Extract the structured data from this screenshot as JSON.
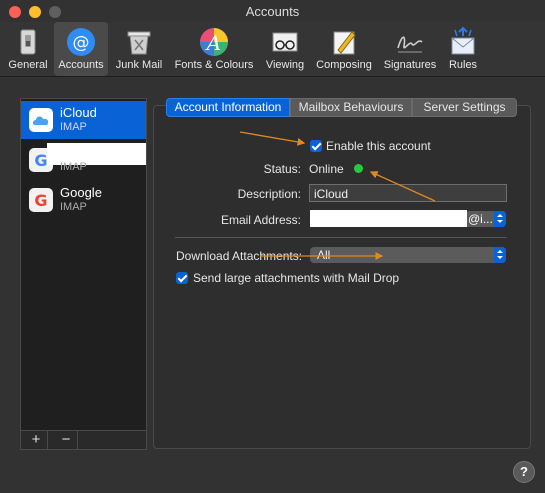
{
  "window": {
    "title": "Accounts"
  },
  "toolbar": {
    "items": [
      {
        "label": "General",
        "icon": "general-icon"
      },
      {
        "label": "Accounts",
        "icon": "accounts-icon"
      },
      {
        "label": "Junk Mail",
        "icon": "junk-mail-icon"
      },
      {
        "label": "Fonts & Colours",
        "icon": "fonts-colours-icon"
      },
      {
        "label": "Viewing",
        "icon": "viewing-icon"
      },
      {
        "label": "Composing",
        "icon": "composing-icon"
      },
      {
        "label": "Signatures",
        "icon": "signatures-icon"
      },
      {
        "label": "Rules",
        "icon": "rules-icon"
      }
    ],
    "selected": "Accounts"
  },
  "sidebar": {
    "accounts": [
      {
        "name": "iCloud",
        "type": "IMAP",
        "selected": true
      },
      {
        "name": "",
        "type": "IMAP",
        "selected": false
      },
      {
        "name": "Google",
        "type": "IMAP",
        "selected": false
      }
    ],
    "add_label": "+",
    "remove_label": "−"
  },
  "tabs": [
    "Account Information",
    "Mailbox Behaviours",
    "Server Settings"
  ],
  "account_info": {
    "enable_label": "Enable this account",
    "enable_checked": true,
    "status_label": "Status:",
    "status_value": "Online",
    "status_color": "#27c93f",
    "description_label": "Description:",
    "description_value": "iCloud",
    "email_label": "Email Address:",
    "email_value": "@i...",
    "download_label": "Download Attachments:",
    "download_value": "All",
    "maildrop_label": "Send large attachments with Mail Drop",
    "maildrop_checked": true
  },
  "help_label": "?",
  "colors": {
    "accent": "#0a63d6",
    "annotation_arrow": "#e08a1e"
  }
}
